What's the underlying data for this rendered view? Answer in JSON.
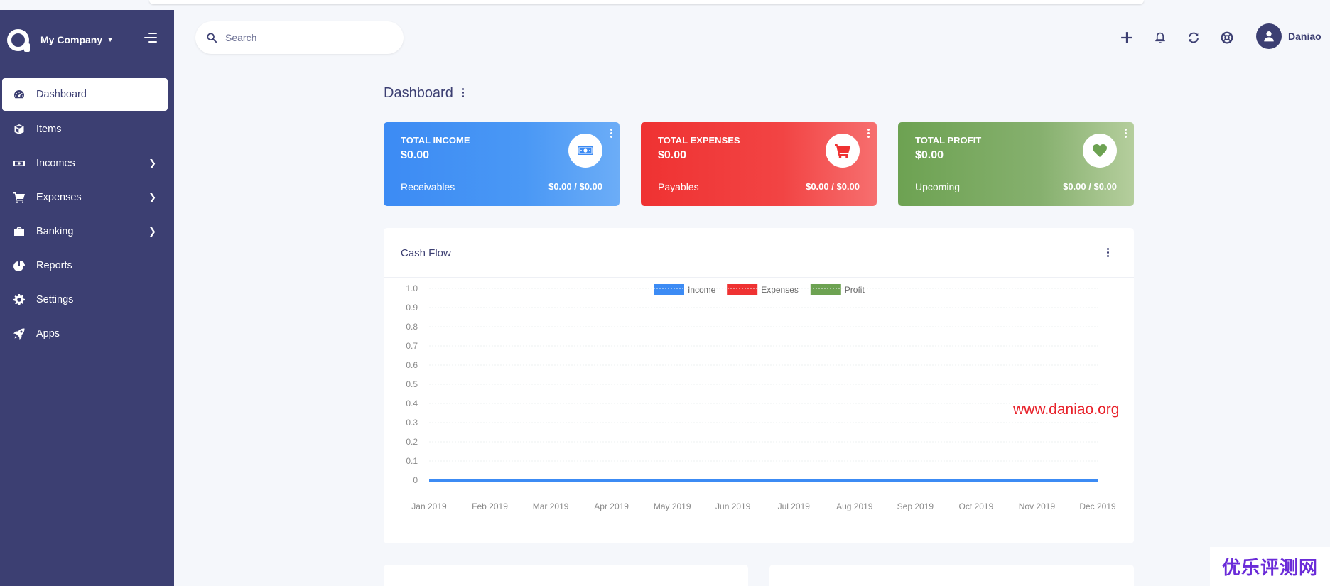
{
  "company": {
    "name": "My Company"
  },
  "search": {
    "placeholder": "Search"
  },
  "user": {
    "name": "Daniao"
  },
  "sidebar": {
    "items": [
      {
        "label": "Dashboard",
        "icon": "dashboard-icon",
        "active": true,
        "has_submenu": false
      },
      {
        "label": "Items",
        "icon": "cube-icon",
        "active": false,
        "has_submenu": false
      },
      {
        "label": "Incomes",
        "icon": "money-icon",
        "active": false,
        "has_submenu": true
      },
      {
        "label": "Expenses",
        "icon": "cart-icon",
        "active": false,
        "has_submenu": true
      },
      {
        "label": "Banking",
        "icon": "briefcase-icon",
        "active": false,
        "has_submenu": true
      },
      {
        "label": "Reports",
        "icon": "pie-chart-icon",
        "active": false,
        "has_submenu": false
      },
      {
        "label": "Settings",
        "icon": "gear-icon",
        "active": false,
        "has_submenu": false
      },
      {
        "label": "Apps",
        "icon": "rocket-icon",
        "active": false,
        "has_submenu": false
      }
    ]
  },
  "header": {
    "icons": [
      "plus-icon",
      "bell-icon",
      "refresh-icon",
      "help-icon"
    ]
  },
  "page": {
    "title": "Dashboard"
  },
  "cards": [
    {
      "label": "TOTAL INCOME",
      "amount": "$0.00",
      "sub_label": "Receivables",
      "sub_value": "$0.00 / $0.00",
      "icon": "money-bill-icon",
      "color": "#3c8bf4"
    },
    {
      "label": "TOTAL EXPENSES",
      "amount": "$0.00",
      "sub_label": "Payables",
      "sub_value": "$0.00 / $0.00",
      "icon": "shopping-cart-icon",
      "color": "#ef3232"
    },
    {
      "label": "TOTAL PROFIT",
      "amount": "$0.00",
      "sub_label": "Upcoming",
      "sub_value": "$0.00 / $0.00",
      "icon": "heart-icon",
      "color": "#6da252"
    }
  ],
  "cashflow": {
    "title": "Cash Flow"
  },
  "chart_data": {
    "type": "line",
    "title": "",
    "xlabel": "",
    "ylabel": "",
    "categories": [
      "Jan 2019",
      "Feb 2019",
      "Mar 2019",
      "Apr 2019",
      "May 2019",
      "Jun 2019",
      "Jul 2019",
      "Aug 2019",
      "Sep 2019",
      "Oct 2019",
      "Nov 2019",
      "Dec 2019"
    ],
    "ylim": [
      0,
      1.0
    ],
    "yticks": [
      "1.0",
      "0.9",
      "0.8",
      "0.7",
      "0.6",
      "0.5",
      "0.4",
      "0.3",
      "0.2",
      "0.1",
      "0"
    ],
    "grid": true,
    "legend_position": "top-center",
    "series": [
      {
        "name": "Income",
        "color": "#3c8bf4",
        "values": [
          0,
          0,
          0,
          0,
          0,
          0,
          0,
          0,
          0,
          0,
          0,
          0
        ]
      },
      {
        "name": "Expenses",
        "color": "#ef3232",
        "values": [
          0,
          0,
          0,
          0,
          0,
          0,
          0,
          0,
          0,
          0,
          0,
          0
        ]
      },
      {
        "name": "Profit",
        "color": "#6da252",
        "values": [
          0,
          0,
          0,
          0,
          0,
          0,
          0,
          0,
          0,
          0,
          0,
          0
        ]
      }
    ]
  },
  "watermark": {
    "text": "www.daniao.org"
  },
  "corner_badge": {
    "text": "优乐评测网"
  }
}
